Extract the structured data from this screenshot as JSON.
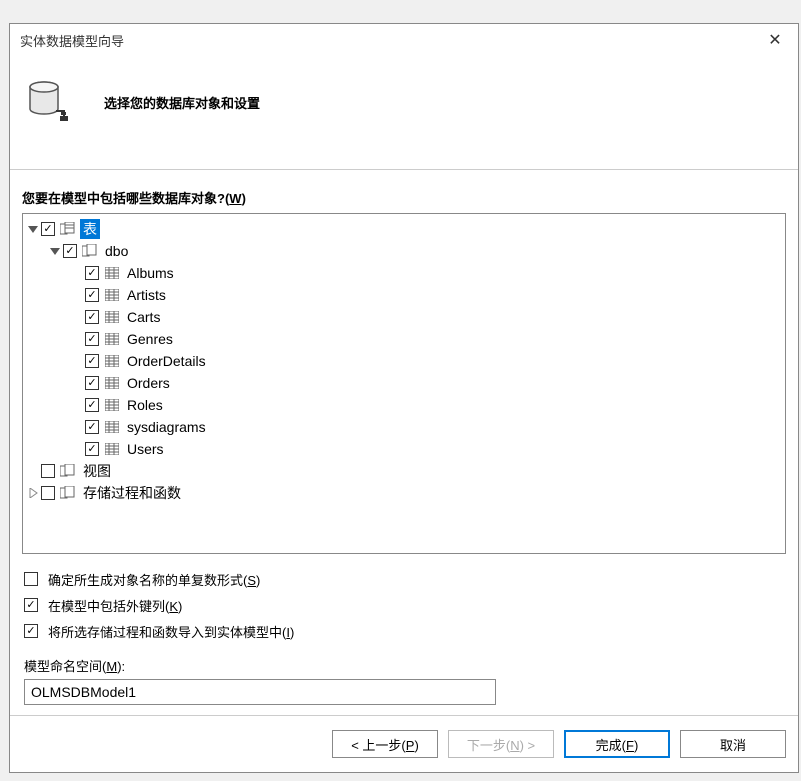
{
  "dialog": {
    "title": "实体数据模型向导",
    "header": "选择您的数据库对象和设置"
  },
  "prompt": {
    "text_before": "您要在模型中包括哪些数据库对象?(",
    "key": "W",
    "text_after": ")"
  },
  "tree": {
    "root_tables": "表",
    "dbo": "dbo",
    "leaves": [
      "Albums",
      "Artists",
      "Carts",
      "Genres",
      "OrderDetails",
      "Orders",
      "Roles",
      "sysdiagrams",
      "Users"
    ],
    "views": "视图",
    "sprocs": "存储过程和函数"
  },
  "options": {
    "pluralize": {
      "text_before": "确定所生成对象名称的单复数形式(",
      "key": "S",
      "text_after": ")",
      "checked": false
    },
    "fkeys": {
      "text_before": "在模型中包括外键列(",
      "key": "K",
      "text_after": ")",
      "checked": true
    },
    "import_sp": {
      "text_before": "将所选存储过程和函数导入到实体模型中(",
      "key": "I",
      "text_after": ")",
      "checked": true
    }
  },
  "namespace": {
    "label_before": "模型命名空间(",
    "label_key": "M",
    "label_after": "):",
    "value": "OLMSDBModel1"
  },
  "buttons": {
    "prev": {
      "t1": "< 上一步(",
      "k": "P",
      "t2": ")"
    },
    "next": {
      "t1": "下一步(",
      "k": "N",
      "t2": ") >"
    },
    "finish": {
      "t1": "完成(",
      "k": "F",
      "t2": ")"
    },
    "cancel": "取消"
  }
}
